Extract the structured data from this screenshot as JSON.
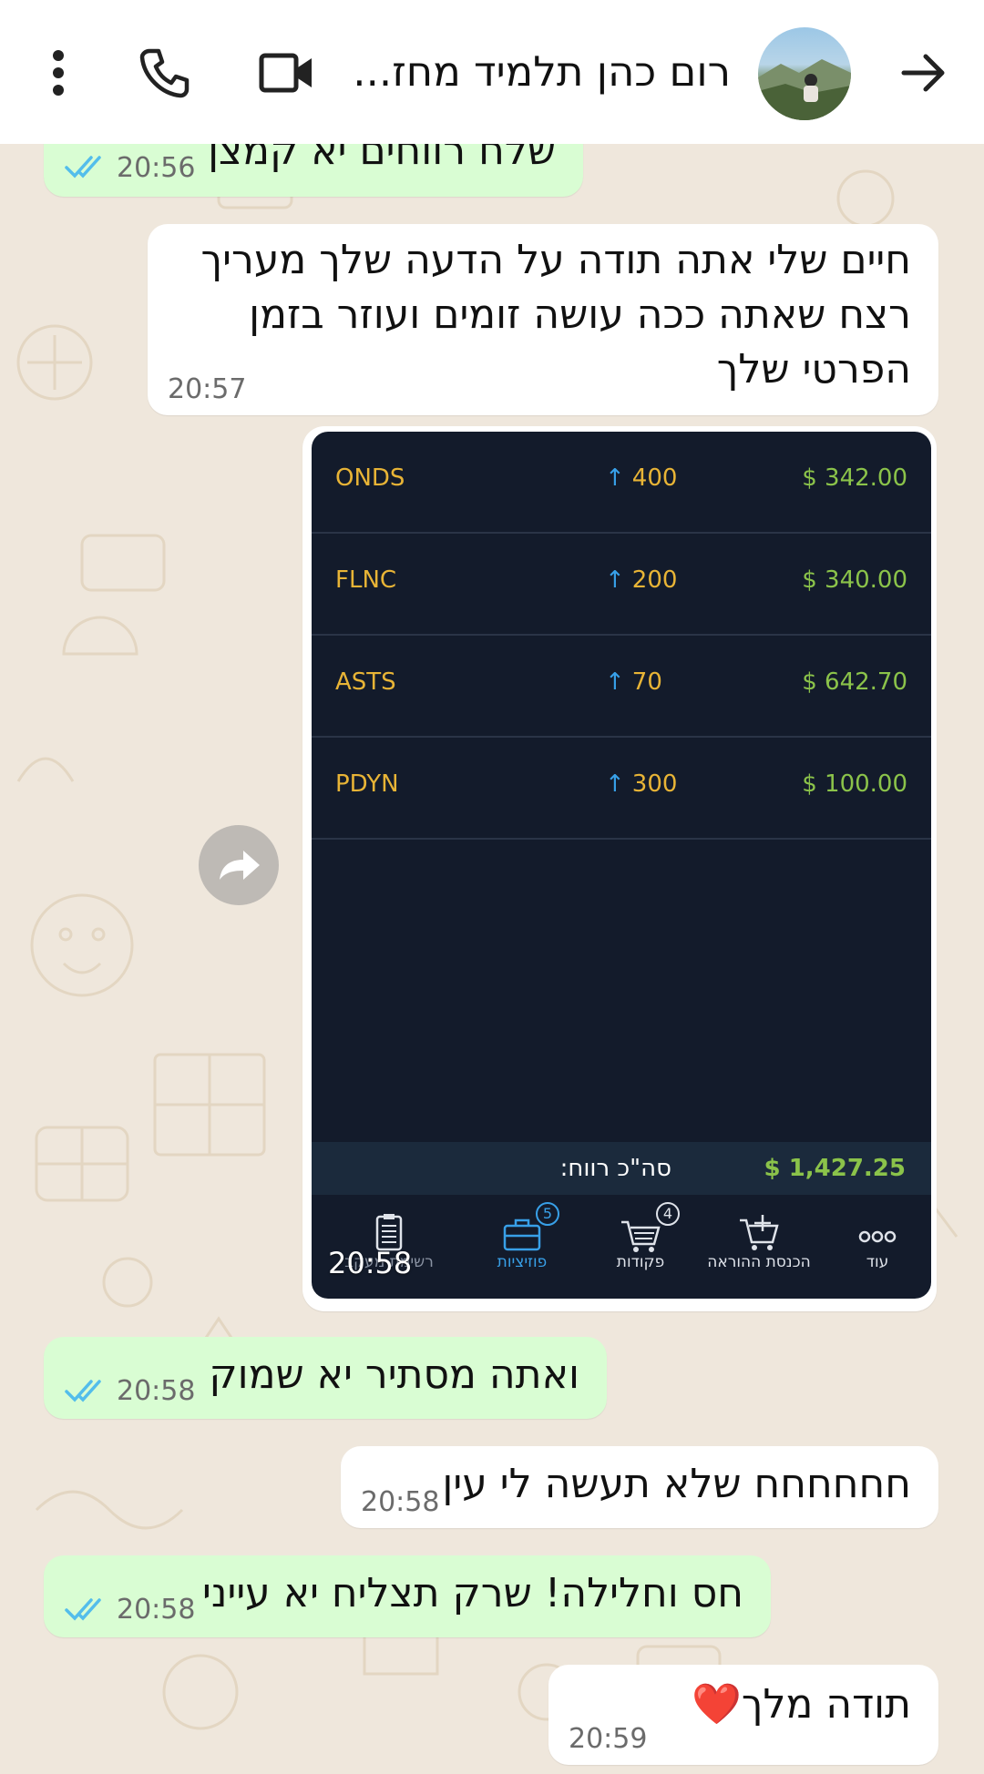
{
  "header": {
    "contact_name": "רום כהן תלמיד מחז...",
    "back_icon": "arrow-right-icon",
    "avatar_icon": "avatar",
    "video_icon": "video-call-icon",
    "phone_icon": "phone-icon",
    "menu_icon": "more-vert-icon"
  },
  "messages": [
    {
      "dir": "out",
      "text": "שלח רווחים יא קמצן",
      "time": "20:56",
      "ticks": "read"
    },
    {
      "dir": "in",
      "lines": [
        "חיים שלי אתה תודה על הדעה שלך מעריך",
        "רצח שאתה ככה עושה זומים ועוזר בזמן",
        "הפרטי שלך"
      ],
      "time": "20:57"
    },
    {
      "dir": "in",
      "type": "image",
      "time": "20:58"
    },
    {
      "dir": "out",
      "text": "ואתה מסתיר יא שמוק",
      "time": "20:58",
      "ticks": "read"
    },
    {
      "dir": "in",
      "text": "חחחחחח שלא תעשה לי עין",
      "time": "20:58"
    },
    {
      "dir": "out",
      "text": "חס וחלילה! שרק תצליח יא עייני",
      "time": "20:58",
      "ticks": "read"
    },
    {
      "dir": "in",
      "text": "תודה מלך❤️",
      "time": "20:59"
    }
  ],
  "trading": {
    "positions": [
      {
        "symbol": "ONDS",
        "qty": "400",
        "arrow": "↑",
        "profit": "$ 342.00"
      },
      {
        "symbol": "FLNC",
        "qty": "200",
        "arrow": "↑",
        "profit": "$ 340.00"
      },
      {
        "symbol": "ASTS",
        "qty": "70",
        "arrow": "↑",
        "profit": "$ 642.70"
      },
      {
        "symbol": "PDYN",
        "qty": "300",
        "arrow": "↑",
        "profit": "$ 100.00"
      }
    ],
    "total_label": "סה\"כ רווח:",
    "total_value": "$ 1,427.25",
    "nav": [
      {
        "label": "עוד",
        "icon": "more-dots-icon"
      },
      {
        "label": "הכנסת ההוראה",
        "icon": "cart-add-icon"
      },
      {
        "label": "פקודות",
        "icon": "cart-icon",
        "badge": "4"
      },
      {
        "label": "פוזיציות",
        "icon": "briefcase-icon",
        "badge": "5",
        "active": true
      },
      {
        "label": "רשימת מעקב",
        "icon": "clipboard-icon"
      }
    ]
  },
  "colors": {
    "outgoing_bubble": "#d9fdd3",
    "incoming_bubble": "#ffffff",
    "read_ticks": "#53bdeb",
    "trade_bg": "#131b2b",
    "symbol": "#e8b436",
    "profit": "#8bc34a"
  }
}
